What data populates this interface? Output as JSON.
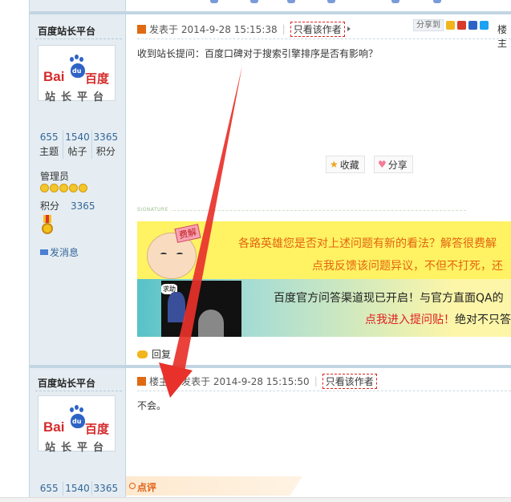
{
  "post1": {
    "author": "百度站长平台",
    "logo": {
      "brand_left": "Bai",
      "brand_mid": "du",
      "brand_right": "百度",
      "platform": "站长平台"
    },
    "stats": [
      {
        "value": "655",
        "label": "主题"
      },
      {
        "value": "1540",
        "label": "帖子"
      },
      {
        "value": "3365",
        "label": "积分"
      }
    ],
    "role": "管理员",
    "score_label": "积分",
    "score_value": "3365",
    "message_link": "发消息",
    "posted": "发表于 2014-9-28 15:15:38",
    "only_author": "只看该作者",
    "share_label": "分享到",
    "floor_label": "楼主",
    "content": "收到站长提问：百度口碑对于搜索引擎排序是否有影响？",
    "favorite_button": "收藏",
    "share_button": "分享",
    "signature_word": "SIGNATURE",
    "banner1": {
      "tag": "费解",
      "line1": "各路英雄您是否对上述问题有新的看法？解答很费解",
      "line2": "点我反馈该问题异议，不但不打死，还"
    },
    "banner2": {
      "sign": "求助",
      "line1": "百度官方问答渠道现已开启！与官方直面QA的",
      "line2_red": "点我进入提问贴！",
      "line2_black": "绝对不只答"
    },
    "reply_link": "回复"
  },
  "post2": {
    "author": "百度站长平台",
    "stats": [
      {
        "value": "655"
      },
      {
        "value": "1540"
      },
      {
        "value": "3365"
      }
    ],
    "floor_label": "楼主",
    "posted": "发表于 2014-9-28 15:15:50",
    "only_author": "只看该作者",
    "content": "不会。",
    "review_label": "点评"
  },
  "colors": {
    "rail_bg": "#e5edf2",
    "link_blue": "#336699",
    "annotation_red": "#e8312a",
    "banner_yellow": "#fff263",
    "banner_orange": "#e3640d"
  }
}
